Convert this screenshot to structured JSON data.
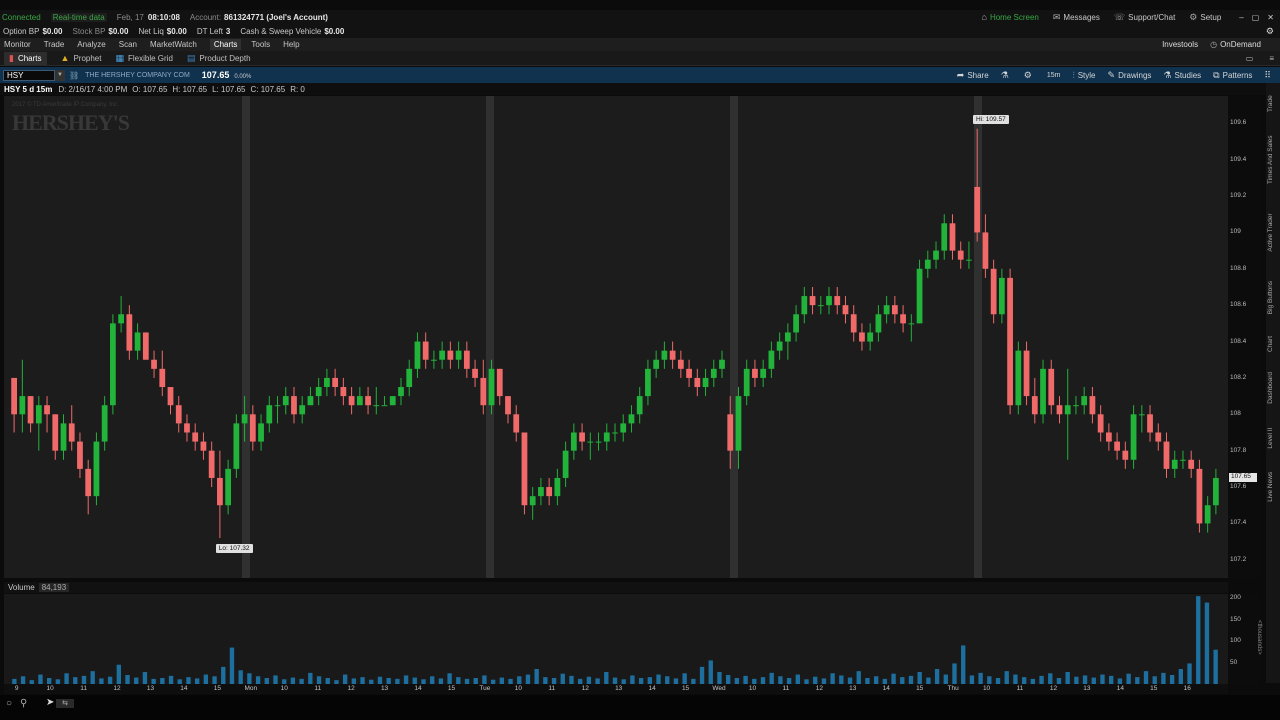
{
  "status_bar": {
    "connected": "Connected",
    "realtime": "Real-time data",
    "date": "Feb, 17",
    "time": "08:10:08",
    "account_label": "Account:",
    "account_value": "861324771 (Joel's Account)",
    "home_screen": "Home Screen",
    "messages": "Messages",
    "support": "Support/Chat",
    "setup": "Setup"
  },
  "balances": {
    "option_bp_label": "Option BP",
    "option_bp": "$0.00",
    "stock_bp_label": "Stock BP",
    "stock_bp": "$0.00",
    "net_liq_label": "Net Liq",
    "net_liq": "$0.00",
    "dt_left_label": "DT Left",
    "dt_left": "3",
    "cash_label": "Cash & Sweep Vehicle",
    "cash": "$0.00"
  },
  "menu": {
    "items": [
      "Monitor",
      "Trade",
      "Analyze",
      "Scan",
      "MarketWatch",
      "Charts",
      "Tools",
      "Help"
    ],
    "investools": "Investools",
    "ondemand": "OnDemand"
  },
  "subtabs": [
    "Charts",
    "Prophet",
    "Flexible Grid",
    "Product Depth"
  ],
  "symbol_bar": {
    "symbol": "HSY",
    "company": "THE HERSHEY COMPANY COM",
    "last": "107.65",
    "change": "0.00%",
    "share": "Share",
    "timeframe": "15m",
    "style": "Style",
    "drawings": "Drawings",
    "studies": "Studies",
    "patterns": "Patterns"
  },
  "ohlc": {
    "label": "HSY 5 d 15m",
    "d": "D: 2/16/17 4:00 PM",
    "o": "O: 107.65",
    "h": "H: 107.65",
    "l": "L: 107.65",
    "c": "C: 107.65",
    "r": "R: 0"
  },
  "watermark": {
    "copyright": "2017 © TD Ameritrade IP Company, Inc.",
    "logo": "HERSHEY'S"
  },
  "annotations": {
    "hi": "Hi: 109.57",
    "lo": "Lo: 107.32"
  },
  "right_tabs": [
    "Trade",
    "Times And Sales",
    "Active Trader",
    "Big Buttons",
    "Chart",
    "Dashboard",
    "Level II",
    "Live News"
  ],
  "volume": {
    "label": "Volume",
    "value": "84,193",
    "units": "<thousands>"
  },
  "colors": {
    "up": "#22b33a",
    "down": "#f06a6a",
    "volume": "#1d6f9f",
    "session": "#303030",
    "accent_bar": "#10324e"
  },
  "chart_data": [
    {
      "type": "candlestick",
      "title": "HSY 5 d 15m",
      "y_ticks": [
        "109.6",
        "109.4",
        "109.2",
        "109",
        "108.8",
        "108.6",
        "108.4",
        "108.2",
        "108",
        "107.8",
        "107.6",
        "107.4",
        "107.2"
      ],
      "ylim": [
        107.1,
        109.75
      ],
      "x_ticks": [
        "9",
        "10",
        "11",
        "12",
        "13",
        "14",
        "15",
        "Mon",
        "10",
        "11",
        "12",
        "13",
        "14",
        "15",
        "Tue",
        "10",
        "11",
        "12",
        "13",
        "14",
        "15",
        "Wed",
        "10",
        "11",
        "12",
        "13",
        "14",
        "15",
        "Thu",
        "10",
        "11",
        "12",
        "13",
        "14",
        "15",
        "16"
      ],
      "session_breaks": [
        8.7,
        35.3,
        62.0,
        88.7
      ],
      "candles": [
        [
          108.2,
          108.2,
          107.9,
          108.0
        ],
        [
          108.0,
          108.3,
          107.9,
          108.1
        ],
        [
          108.1,
          108.1,
          107.9,
          107.95
        ],
        [
          107.95,
          108.1,
          107.8,
          108.05
        ],
        [
          108.05,
          108.1,
          107.9,
          108.0
        ],
        [
          108.0,
          108.0,
          107.75,
          107.8
        ],
        [
          107.8,
          108.0,
          107.75,
          107.95
        ],
        [
          107.95,
          108.05,
          107.8,
          107.85
        ],
        [
          107.85,
          107.9,
          107.65,
          107.7
        ],
        [
          107.7,
          107.75,
          107.45,
          107.55
        ],
        [
          107.55,
          107.9,
          107.5,
          107.85
        ],
        [
          107.85,
          108.1,
          107.8,
          108.05
        ],
        [
          108.05,
          108.55,
          108.0,
          108.5
        ],
        [
          108.5,
          108.65,
          108.45,
          108.55
        ],
        [
          108.55,
          108.6,
          108.3,
          108.35
        ],
        [
          108.35,
          108.5,
          108.3,
          108.45
        ],
        [
          108.45,
          108.45,
          108.3,
          108.3
        ],
        [
          108.3,
          108.35,
          108.2,
          108.25
        ],
        [
          108.25,
          108.35,
          108.1,
          108.15
        ],
        [
          108.15,
          108.15,
          108.0,
          108.05
        ],
        [
          108.05,
          108.1,
          107.9,
          107.95
        ],
        [
          107.95,
          108.0,
          107.85,
          107.9
        ],
        [
          107.9,
          107.95,
          107.8,
          107.85
        ],
        [
          107.85,
          107.9,
          107.75,
          107.8
        ],
        [
          107.8,
          107.85,
          107.6,
          107.65
        ],
        [
          107.65,
          107.8,
          107.32,
          107.5
        ],
        [
          107.5,
          107.75,
          107.45,
          107.7
        ],
        [
          107.7,
          108.0,
          107.65,
          107.95
        ],
        [
          107.95,
          108.1,
          107.85,
          108.0
        ],
        [
          108.0,
          108.05,
          107.8,
          107.85
        ],
        [
          107.85,
          108.0,
          107.8,
          107.95
        ],
        [
          107.95,
          108.1,
          107.9,
          108.05
        ],
        [
          108.05,
          108.1,
          107.95,
          108.05
        ],
        [
          108.05,
          108.15,
          108.0,
          108.1
        ],
        [
          108.1,
          108.15,
          107.95,
          108.0
        ],
        [
          108.0,
          108.1,
          107.95,
          108.05
        ],
        [
          108.05,
          108.15,
          108.05,
          108.1
        ],
        [
          108.1,
          108.2,
          108.05,
          108.15
        ],
        [
          108.15,
          108.25,
          108.1,
          108.2
        ],
        [
          108.2,
          108.25,
          108.1,
          108.15
        ],
        [
          108.15,
          108.2,
          108.05,
          108.1
        ],
        [
          108.1,
          108.15,
          108.0,
          108.05
        ],
        [
          108.05,
          108.15,
          108.05,
          108.1
        ],
        [
          108.1,
          108.15,
          108.0,
          108.05
        ],
        [
          108.05,
          108.15,
          108.0,
          108.05
        ],
        [
          108.05,
          108.1,
          108.05,
          108.05
        ],
        [
          108.05,
          108.1,
          108.05,
          108.1
        ],
        [
          108.1,
          108.2,
          108.05,
          108.15
        ],
        [
          108.15,
          108.3,
          108.1,
          108.25
        ],
        [
          108.25,
          108.45,
          108.2,
          108.4
        ],
        [
          108.4,
          108.45,
          108.25,
          108.3
        ],
        [
          108.3,
          108.35,
          108.25,
          108.3
        ],
        [
          108.3,
          108.4,
          108.25,
          108.35
        ],
        [
          108.35,
          108.4,
          108.25,
          108.3
        ],
        [
          108.3,
          108.4,
          108.25,
          108.35
        ],
        [
          108.35,
          108.4,
          108.2,
          108.25
        ],
        [
          108.25,
          108.3,
          108.15,
          108.2
        ],
        [
          108.2,
          108.3,
          108.0,
          108.05
        ],
        [
          108.05,
          108.3,
          108.0,
          108.25
        ],
        [
          108.25,
          108.25,
          108.05,
          108.1
        ],
        [
          108.1,
          108.1,
          107.95,
          108.0
        ],
        [
          108.0,
          108.05,
          107.85,
          107.9
        ],
        [
          107.9,
          107.9,
          107.45,
          107.5
        ],
        [
          107.5,
          107.6,
          107.42,
          107.55
        ],
        [
          107.55,
          107.65,
          107.5,
          107.6
        ],
        [
          107.6,
          107.65,
          107.5,
          107.55
        ],
        [
          107.55,
          107.7,
          107.5,
          107.65
        ],
        [
          107.65,
          107.85,
          107.6,
          107.8
        ],
        [
          107.8,
          107.95,
          107.75,
          107.9
        ],
        [
          107.9,
          107.95,
          107.8,
          107.85
        ],
        [
          107.85,
          107.9,
          107.75,
          107.85
        ],
        [
          107.85,
          107.9,
          107.8,
          107.85
        ],
        [
          107.85,
          107.95,
          107.8,
          107.9
        ],
        [
          107.9,
          107.95,
          107.85,
          107.9
        ],
        [
          107.9,
          108.0,
          107.85,
          107.95
        ],
        [
          107.95,
          108.05,
          107.9,
          108.0
        ],
        [
          108.0,
          108.15,
          107.95,
          108.1
        ],
        [
          108.1,
          108.3,
          108.05,
          108.25
        ],
        [
          108.25,
          108.35,
          108.2,
          108.3
        ],
        [
          108.3,
          108.4,
          108.25,
          108.35
        ],
        [
          108.35,
          108.4,
          108.25,
          108.3
        ],
        [
          108.3,
          108.35,
          108.2,
          108.25
        ],
        [
          108.25,
          108.3,
          108.15,
          108.2
        ],
        [
          108.2,
          108.25,
          108.1,
          108.15
        ],
        [
          108.15,
          108.25,
          108.1,
          108.2
        ],
        [
          108.2,
          108.3,
          108.15,
          108.25
        ],
        [
          108.25,
          108.35,
          108.2,
          108.3
        ],
        [
          108.0,
          108.1,
          107.7,
          107.8
        ],
        [
          107.8,
          108.15,
          107.7,
          108.1
        ],
        [
          108.1,
          108.3,
          108.05,
          108.25
        ],
        [
          108.25,
          108.3,
          108.15,
          108.2
        ],
        [
          108.2,
          108.3,
          108.15,
          108.25
        ],
        [
          108.25,
          108.4,
          108.2,
          108.35
        ],
        [
          108.35,
          108.45,
          108.3,
          108.4
        ],
        [
          108.4,
          108.5,
          108.3,
          108.45
        ],
        [
          108.45,
          108.6,
          108.4,
          108.55
        ],
        [
          108.55,
          108.7,
          108.5,
          108.65
        ],
        [
          108.65,
          108.7,
          108.55,
          108.6
        ],
        [
          108.6,
          108.65,
          108.55,
          108.6
        ],
        [
          108.6,
          108.7,
          108.55,
          108.65
        ],
        [
          108.65,
          108.7,
          108.55,
          108.6
        ],
        [
          108.6,
          108.65,
          108.5,
          108.55
        ],
        [
          108.55,
          108.6,
          108.4,
          108.45
        ],
        [
          108.45,
          108.5,
          108.35,
          108.4
        ],
        [
          108.4,
          108.5,
          108.35,
          108.45
        ],
        [
          108.45,
          108.6,
          108.4,
          108.55
        ],
        [
          108.55,
          108.65,
          108.5,
          108.6
        ],
        [
          108.6,
          108.65,
          108.5,
          108.55
        ],
        [
          108.55,
          108.6,
          108.45,
          108.5
        ],
        [
          108.5,
          108.55,
          108.4,
          108.5
        ],
        [
          108.5,
          108.85,
          108.5,
          108.8
        ],
        [
          108.8,
          108.9,
          108.75,
          108.85
        ],
        [
          108.85,
          108.95,
          108.8,
          108.9
        ],
        [
          108.9,
          109.1,
          108.85,
          109.05
        ],
        [
          109.05,
          109.1,
          108.85,
          108.9
        ],
        [
          108.9,
          108.95,
          108.8,
          108.85
        ],
        [
          108.85,
          108.95,
          108.8,
          108.85
        ],
        [
          109.25,
          109.57,
          108.95,
          109.0
        ],
        [
          109.0,
          109.1,
          108.75,
          108.8
        ],
        [
          108.8,
          108.85,
          108.5,
          108.55
        ],
        [
          108.55,
          108.8,
          108.5,
          108.75
        ],
        [
          108.75,
          108.8,
          108.0,
          108.05
        ],
        [
          108.05,
          108.4,
          108.0,
          108.35
        ],
        [
          108.35,
          108.4,
          108.05,
          108.1
        ],
        [
          108.1,
          108.2,
          107.95,
          108.0
        ],
        [
          108.0,
          108.3,
          107.95,
          108.25
        ],
        [
          108.25,
          108.3,
          108.0,
          108.05
        ],
        [
          108.05,
          108.1,
          107.95,
          108.0
        ],
        [
          108.0,
          108.25,
          107.75,
          108.05
        ],
        [
          108.05,
          108.1,
          108.0,
          108.05
        ],
        [
          108.05,
          108.15,
          108.0,
          108.1
        ],
        [
          108.1,
          108.15,
          107.95,
          108.0
        ],
        [
          108.0,
          108.05,
          107.85,
          107.9
        ],
        [
          107.9,
          107.95,
          107.8,
          107.85
        ],
        [
          107.85,
          107.9,
          107.75,
          107.8
        ],
        [
          107.8,
          107.85,
          107.7,
          107.75
        ],
        [
          107.75,
          108.05,
          107.7,
          108.0
        ],
        [
          108.0,
          108.05,
          107.9,
          108.0
        ],
        [
          108.0,
          108.05,
          107.85,
          107.9
        ],
        [
          107.9,
          107.95,
          107.8,
          107.85
        ],
        [
          107.85,
          107.9,
          107.65,
          107.7
        ],
        [
          107.7,
          107.8,
          107.65,
          107.75
        ],
        [
          107.75,
          107.8,
          107.7,
          107.75
        ],
        [
          107.75,
          107.8,
          107.65,
          107.7
        ],
        [
          107.7,
          107.75,
          107.35,
          107.4
        ],
        [
          107.4,
          107.55,
          107.35,
          107.5
        ],
        [
          107.5,
          107.7,
          107.45,
          107.65
        ]
      ]
    },
    {
      "type": "bar",
      "title": "Volume",
      "y_ticks": [
        "200",
        "150",
        "100",
        "50"
      ],
      "ylim": [
        0,
        210
      ],
      "values": [
        12,
        18,
        9,
        22,
        14,
        11,
        25,
        16,
        19,
        30,
        13,
        17,
        45,
        21,
        15,
        28,
        12,
        14,
        19,
        11,
        16,
        13,
        22,
        18,
        40,
        85,
        32,
        25,
        18,
        14,
        20,
        11,
        15,
        12,
        26,
        18,
        14,
        9,
        22,
        13,
        16,
        10,
        17,
        14,
        12,
        20,
        15,
        11,
        18,
        13,
        25,
        16,
        12,
        14,
        20,
        10,
        15,
        12,
        18,
        22,
        35,
        16,
        14,
        24,
        19,
        12,
        17,
        13,
        28,
        15,
        11,
        20,
        14,
        16,
        22,
        18,
        13,
        25,
        12,
        40,
        55,
        28,
        21,
        14,
        19,
        12,
        16,
        26,
        18,
        14,
        22,
        11,
        17,
        13,
        25,
        20,
        15,
        30,
        14,
        18,
        12,
        24,
        16,
        19,
        28,
        15,
        35,
        22,
        48,
        90,
        20,
        26,
        18,
        14,
        30,
        22,
        16,
        12,
        19,
        25,
        14,
        28,
        17,
        20,
        15,
        22,
        19,
        13,
        24,
        16,
        30,
        18,
        26,
        21,
        35,
        48,
        205,
        190,
        80
      ]
    }
  ]
}
